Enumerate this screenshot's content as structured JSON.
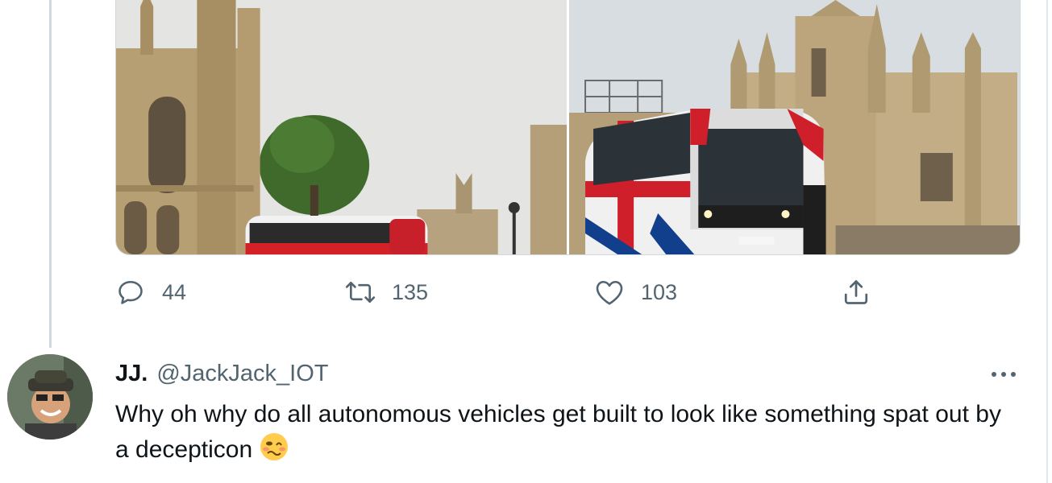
{
  "tweet": {
    "actions": {
      "reply_count": "44",
      "retweet_count": "135",
      "like_count": "103"
    },
    "media": [
      {
        "icon": "photo-kings-college-bus"
      },
      {
        "icon": "photo-union-jack-autonomous-bus"
      }
    ]
  },
  "reply": {
    "display_name": "JJ.",
    "handle": "@JackJack_IOT",
    "text": "Why oh why do all autonomous vehicles get built to look like something spat out by a decepticon",
    "emoji": "woozy-face-emoji"
  },
  "colors": {
    "icon_gray": "#536471",
    "border": "#cfd9de",
    "text": "#0f1419"
  }
}
